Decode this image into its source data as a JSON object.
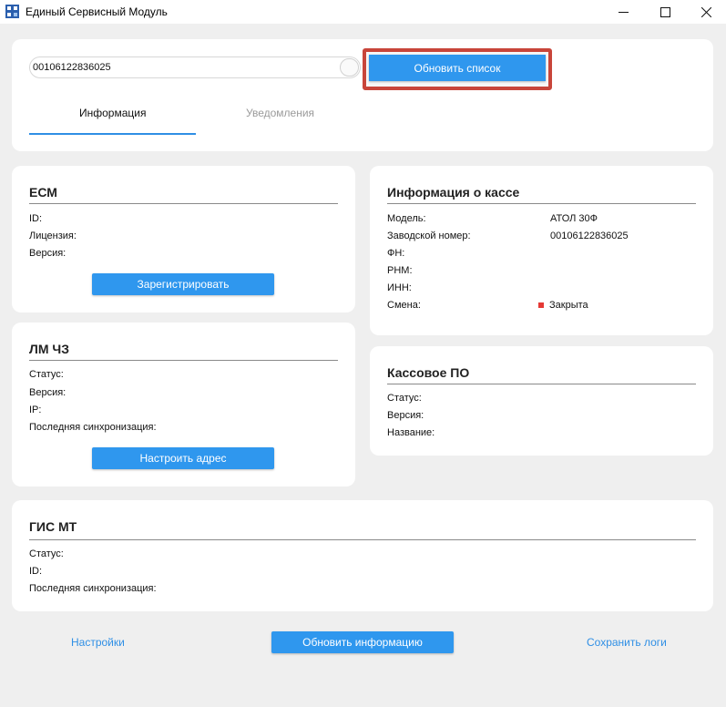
{
  "window": {
    "title": "Единый Сервисный Модуль",
    "icon": "app-grid-icon",
    "controls": [
      "minimize-icon",
      "maximize-icon",
      "close-icon"
    ]
  },
  "top": {
    "device_combo_value": "00106122836025",
    "refresh_list_label": "Обновить список",
    "tabs": [
      {
        "label": "Информация",
        "active": true
      },
      {
        "label": "Уведомления",
        "active": false
      }
    ]
  },
  "ecm": {
    "title": "ЕСМ",
    "rows": [
      {
        "label": "ID:"
      },
      {
        "label": "Лицензия:"
      },
      {
        "label": "Версия:"
      }
    ],
    "button": "Зарегистрировать"
  },
  "lm": {
    "title": "ЛМ ЧЗ",
    "rows": [
      {
        "label": "Статус:"
      },
      {
        "label": "Версия:"
      },
      {
        "label": "IP:"
      },
      {
        "label": "Последняя синхронизация:"
      }
    ],
    "button": "Настроить адрес"
  },
  "cash_info": {
    "title": "Информация о кассе",
    "rows": [
      {
        "label": "Модель:",
        "value": "АТОЛ 30Ф"
      },
      {
        "label": "Заводской номер:",
        "value": "00106122836025"
      },
      {
        "label": "ФН:",
        "value": ""
      },
      {
        "label": "РНМ:",
        "value": ""
      },
      {
        "label": "ИНН:",
        "value": ""
      },
      {
        "label": "Смена:",
        "value": "Закрыта"
      }
    ],
    "shift_status_color": "#e53935"
  },
  "pos_software": {
    "title": "Кассовое ПО",
    "rows": [
      {
        "label": "Статус:"
      },
      {
        "label": "Версия:"
      },
      {
        "label": "Название:"
      }
    ]
  },
  "gis": {
    "title": "ГИС МТ",
    "rows": [
      {
        "label": "Статус:"
      },
      {
        "label": "ID:"
      },
      {
        "label": "Последняя синхронизация:"
      }
    ]
  },
  "footer": {
    "settings_label": "Настройки",
    "refresh_info_label": "Обновить информацию",
    "save_logs_label": "Сохранить логи"
  },
  "colors": {
    "accent": "#2f97ee",
    "link": "#2f8fe5",
    "highlight_border": "#c8453a"
  }
}
